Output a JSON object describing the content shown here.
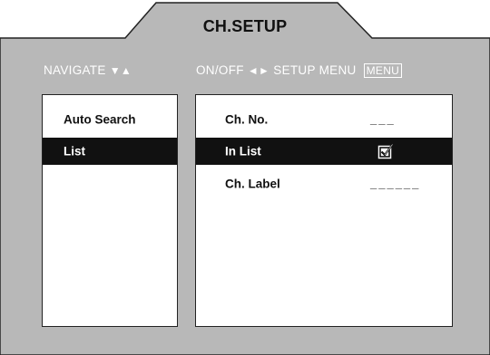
{
  "title": "CH.SETUP",
  "hints": {
    "navigate": "NAVIGATE",
    "navigate_glyph": "▼▲",
    "onoff": "ON/OFF",
    "onoff_glyph": "◄►",
    "setup_menu": "SETUP MENU",
    "menu_key": "MENU"
  },
  "left_menu": {
    "items": [
      {
        "label": "Auto Search",
        "selected": false
      },
      {
        "label": "List",
        "selected": true
      }
    ]
  },
  "right_panel": {
    "rows": [
      {
        "label": "Ch. No.",
        "value": "___",
        "selected": false
      },
      {
        "label": "In List",
        "checked": true,
        "selected": true
      },
      {
        "label": "Ch. Label",
        "value": "______",
        "selected": false
      }
    ]
  },
  "colors": {
    "frame_gray": "#b8b8b8",
    "selected_bg": "#111111",
    "panel_bg": "#ffffff"
  },
  "icons": [
    "checkbox-checked-icon",
    "triangle-down-icon",
    "triangle-up-icon",
    "triangle-left-icon",
    "triangle-right-icon"
  ]
}
